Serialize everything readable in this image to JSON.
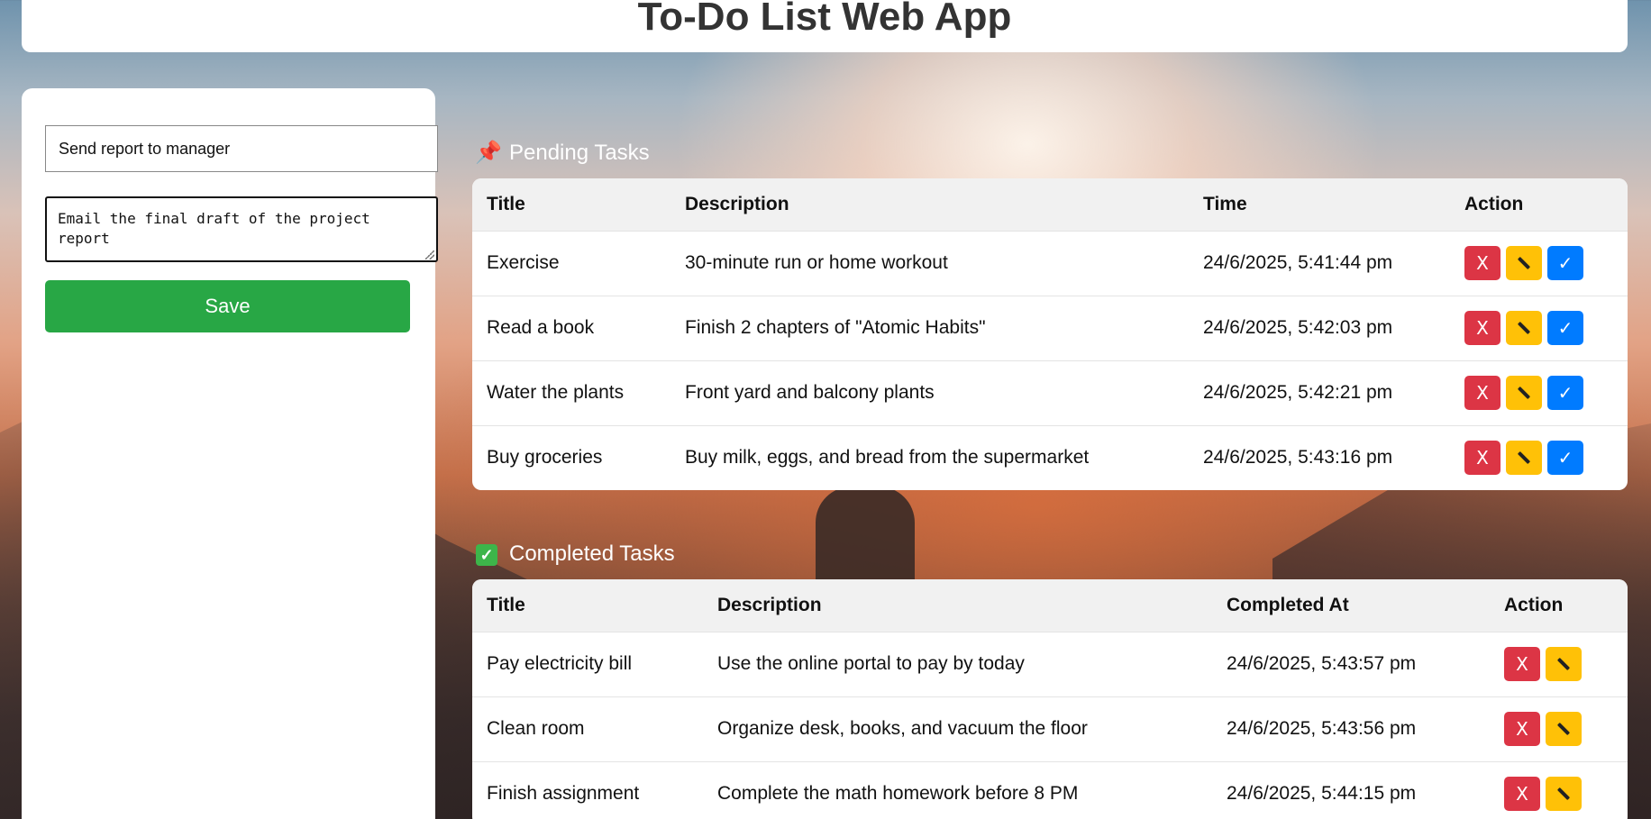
{
  "app": {
    "title": "To-Do List Web App"
  },
  "form": {
    "title_value": "Send report to manager",
    "description_value": "Email the final draft of the project report",
    "save_label": "Save"
  },
  "pending": {
    "heading": "Pending Tasks",
    "heading_icon": "pushpin-icon",
    "columns": [
      "Title",
      "Description",
      "Time",
      "Action"
    ],
    "rows": [
      {
        "title": "Exercise",
        "description": "30-minute run or home workout",
        "time": "24/6/2025, 5:41:44 pm"
      },
      {
        "title": "Read a book",
        "description": "Finish 2 chapters of \"Atomic Habits\"",
        "time": "24/6/2025, 5:42:03 pm"
      },
      {
        "title": "Water the plants",
        "description": "Front yard and balcony plants",
        "time": "24/6/2025, 5:42:21 pm"
      },
      {
        "title": "Buy groceries",
        "description": "Buy milk, eggs, and bread from the supermarket",
        "time": "24/6/2025, 5:43:16 pm"
      }
    ]
  },
  "completed": {
    "heading": "Completed Tasks",
    "heading_icon": "check-box-icon",
    "columns": [
      "Title",
      "Description",
      "Completed At",
      "Action"
    ],
    "rows": [
      {
        "title": "Pay electricity bill",
        "description": "Use the online portal to pay by today",
        "time": "24/6/2025, 5:43:57 pm"
      },
      {
        "title": "Clean room",
        "description": "Organize desk, books, and vacuum the floor",
        "time": "24/6/2025, 5:43:56 pm"
      },
      {
        "title": "Finish assignment",
        "description": "Complete the math homework before 8 PM",
        "time": "24/6/2025, 5:44:15 pm"
      }
    ]
  },
  "actions": {
    "delete": "X",
    "done": "✓",
    "edit_icon": "pencil-icon"
  },
  "colors": {
    "save": "#28a745",
    "delete": "#dc3545",
    "edit": "#ffc107",
    "done": "#007bff"
  }
}
